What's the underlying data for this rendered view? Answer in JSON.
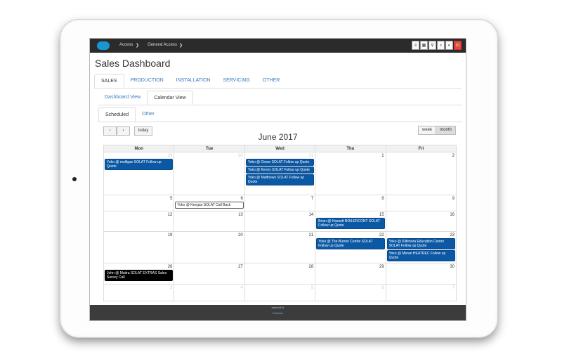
{
  "topbar": {
    "crumbs": [
      "Access",
      "General Access"
    ],
    "icons": [
      "list-icon",
      "grid-icon",
      "pin-icon",
      "search-icon",
      "contrast-icon",
      "power-icon"
    ]
  },
  "page": {
    "title": "Sales Dashboard"
  },
  "main_tabs": [
    "SALES",
    "PRODUCTION",
    "INSTALLATION",
    "SERVICING",
    "OTHER"
  ],
  "view_tabs": [
    "Dashboard View",
    "Calendar View"
  ],
  "sched_tabs": [
    "Scheduled",
    "Other"
  ],
  "calendar": {
    "prev": "‹",
    "next": "›",
    "today": "today",
    "view_week": "week",
    "view_month": "month",
    "title": "June 2017",
    "days": [
      "Mon",
      "Tue",
      "Wed",
      "Thu",
      "Fri"
    ],
    "weeks": [
      [
        "29",
        "30",
        "31",
        "1",
        "2"
      ],
      [
        "5",
        "6",
        "7",
        "8",
        "9"
      ],
      [
        "12",
        "13",
        "14",
        "15",
        "16"
      ],
      [
        "19",
        "20",
        "21",
        "22",
        "23"
      ],
      [
        "26",
        "27",
        "28",
        "29",
        "30"
      ],
      [
        "3",
        "4",
        "5",
        "6",
        "7"
      ]
    ],
    "events": {
      "w0d0": [
        "Yoko @ mulligan SOLAT Follow up Quote"
      ],
      "w0d2": [
        "Yoko @ Orose SOLAT Follow up Quote",
        "Yoko @ Kenny SOLAT Follow up Quote",
        "Yoko @ Matthews SOLAT Follow up Quote"
      ],
      "w1d1": [
        "Yoko @ Keegan SOLAT Call Back"
      ],
      "w2d3": [
        "Brian @ Hassett BOILERCONT SOLAT Follow up Quote"
      ],
      "w3d3": [
        "Yoko @ The Burren Centre SOLAT Follow up Quote"
      ],
      "w3d4": [
        "Yoko @ Kilfenora Education Centre SOLAT Follow up Quote",
        "Yoko @ Moran HEATREC Follow up Quote"
      ],
      "w4d0": [
        "John @ Maitra SOLAT EXTRAS Sales Survey Call"
      ]
    }
  },
  "footer": {
    "line1": "www.ctl.ie",
    "line2": "Software"
  }
}
